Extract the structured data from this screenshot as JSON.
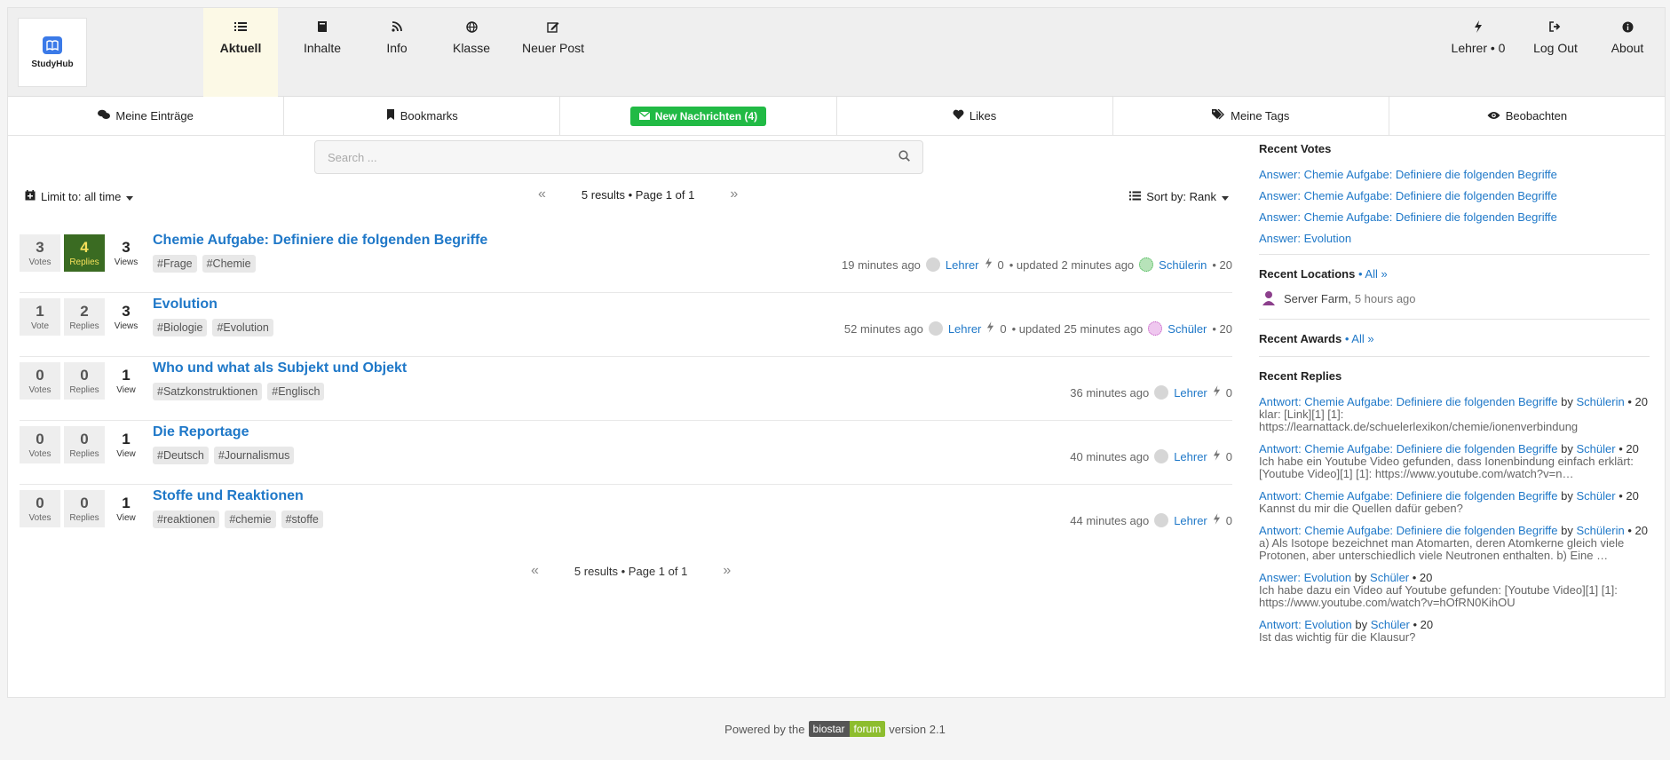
{
  "brand": {
    "name": "StudyHub"
  },
  "topmenu": [
    {
      "label": "Aktuell",
      "icon": "list-icon",
      "active": true
    },
    {
      "label": "Inhalte",
      "icon": "book-icon"
    },
    {
      "label": "Info",
      "icon": "rss-icon"
    },
    {
      "label": "Klasse",
      "icon": "globe-icon"
    },
    {
      "label": "Neuer Post",
      "icon": "edit-icon"
    }
  ],
  "rightmenu": [
    {
      "label": "Lehrer • 0",
      "icon": "bolt-icon"
    },
    {
      "label": "Log Out",
      "icon": "sign-out-icon"
    },
    {
      "label": "About",
      "icon": "info-icon"
    }
  ],
  "subnav": [
    {
      "label": "Meine Einträge",
      "icon": "comments-icon"
    },
    {
      "label": "Bookmarks",
      "icon": "bookmark-icon"
    },
    {
      "label": "New Nachrichten (4)",
      "icon": "envelope-icon",
      "highlight": true
    },
    {
      "label": "Likes",
      "icon": "heart-icon"
    },
    {
      "label": "Meine Tags",
      "icon": "tags-icon"
    },
    {
      "label": "Beobachten",
      "icon": "eye-icon"
    }
  ],
  "search": {
    "placeholder": "Search ..."
  },
  "controls": {
    "limit": "Limit to: all time",
    "pager_text": "5 results • Page 1 of 1",
    "sort": "Sort by: Rank",
    "prev": "«",
    "next": "»"
  },
  "posts": [
    {
      "votes": "3",
      "votes_label": "Votes",
      "replies": "4",
      "replies_label": "Replies",
      "replies_highlight": true,
      "views": "3",
      "views_label": "Views",
      "title": "Chemie Aufgabe: Definiere die folgenden Begriffe",
      "tags": [
        "#Frage",
        "#Chemie"
      ],
      "time": "19 minutes ago",
      "author": "Lehrer",
      "score": "0",
      "updated": "• updated 2 minutes ago",
      "updater": "Schülerin",
      "updater_score": "• 20"
    },
    {
      "votes": "1",
      "votes_label": "Vote",
      "replies": "2",
      "replies_label": "Replies",
      "replies_highlight": false,
      "views": "3",
      "views_label": "Views",
      "title": "Evolution",
      "tags": [
        "#Biologie",
        "#Evolution"
      ],
      "time": "52 minutes ago",
      "author": "Lehrer",
      "score": "0",
      "updated": "• updated 25 minutes ago",
      "updater": "Schüler",
      "updater_score": "• 20"
    },
    {
      "votes": "0",
      "votes_label": "Votes",
      "replies": "0",
      "replies_label": "Replies",
      "replies_highlight": false,
      "views": "1",
      "views_label": "View",
      "title": "Who und what als Subjekt und Objekt",
      "tags": [
        "#Satzkonstruktionen",
        "#Englisch"
      ],
      "time": "36 minutes ago",
      "author": "Lehrer",
      "score": "0"
    },
    {
      "votes": "0",
      "votes_label": "Votes",
      "replies": "0",
      "replies_label": "Replies",
      "replies_highlight": false,
      "views": "1",
      "views_label": "View",
      "title": "Die Reportage",
      "tags": [
        "#Deutsch",
        "#Journalismus"
      ],
      "time": "40 minutes ago",
      "author": "Lehrer",
      "score": "0"
    },
    {
      "votes": "0",
      "votes_label": "Votes",
      "replies": "0",
      "replies_label": "Replies",
      "replies_highlight": false,
      "views": "1",
      "views_label": "View",
      "title": "Stoffe und Reaktionen",
      "tags": [
        "#reaktionen",
        "#chemie",
        "#stoffe"
      ],
      "time": "44 minutes ago",
      "author": "Lehrer",
      "score": "0"
    }
  ],
  "sidebar": {
    "votes_title": "Recent Votes",
    "votes": [
      "Answer: Chemie Aufgabe: Definiere die folgenden Begriffe",
      "Answer: Chemie Aufgabe: Definiere die folgenden Begriffe",
      "Answer: Chemie Aufgabe: Definiere die folgenden Begriffe",
      "Answer: Evolution"
    ],
    "locations_title": "Recent Locations",
    "all_link": "• All »",
    "location_name": "Server Farm,",
    "location_time": "5 hours ago",
    "awards_title": "Recent Awards",
    "replies_title": "Recent Replies",
    "replies": [
      {
        "title": "Antwort: Chemie Aufgabe: Definiere die folgenden Begriffe",
        "by": "by",
        "user": "Schülerin",
        "score": "• 20",
        "snippet": "klar: [Link][1] [1]: https://learnattack.de/schuelerlexikon/chemie/ionenverbindung"
      },
      {
        "title": "Antwort: Chemie Aufgabe: Definiere die folgenden Begriffe",
        "by": "by",
        "user": "Schüler",
        "score": "• 20",
        "snippet": "Ich habe ein Youtube Video gefunden, dass Ionenbindung einfach erklärt: [Youtube Video][1] [1]: https://www.youtube.com/watch?v=n…"
      },
      {
        "title": "Antwort: Chemie Aufgabe: Definiere die folgenden Begriffe",
        "by": "by",
        "user": "Schüler",
        "score": "• 20",
        "snippet": "Kannst du mir die Quellen dafür geben?"
      },
      {
        "title": "Antwort: Chemie Aufgabe: Definiere die folgenden Begriffe",
        "by": "by",
        "user": "Schülerin",
        "score": "• 20",
        "snippet": "a) Als Isotope bezeichnet man Atomarten, deren Atomkerne gleich viele Protonen, aber unterschiedlich viele Neutronen enthalten. b) Eine …"
      },
      {
        "title": "Answer: Evolution",
        "by": "by",
        "user": "Schüler",
        "score": "• 20",
        "snippet": "Ich habe dazu ein Video auf Youtube gefunden: [Youtube Video][1] [1]: https://www.youtube.com/watch?v=hOfRN0KihOU"
      },
      {
        "title": "Antwort: Evolution",
        "by": "by",
        "user": "Schüler",
        "score": "• 20",
        "snippet": "Ist das wichtig für die Klausur?"
      }
    ]
  },
  "footer": {
    "prefix": "Powered by the",
    "badge1": "biostar",
    "badge2": "forum",
    "suffix": "version 2.1"
  },
  "colors": {
    "link": "#1f78c8",
    "badge_green": "#21ba45",
    "highlight_bg": "#3a6b22",
    "highlight_text": "#f5e05a"
  }
}
